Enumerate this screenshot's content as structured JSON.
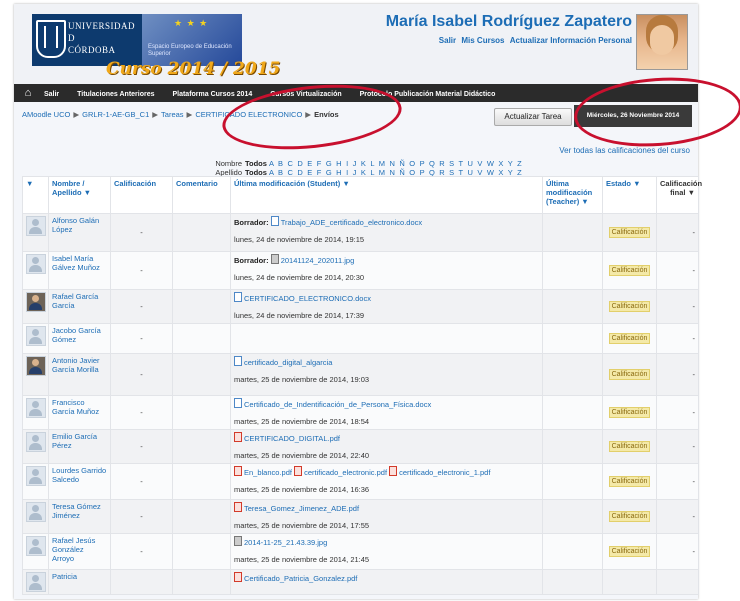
{
  "header": {
    "university": [
      "UNIVERSIDAD",
      "D",
      "CÓRDOBA"
    ],
    "eu_text": "Espacio Europeo de Educación Superior",
    "course_year": "Curso 2014 / 2015",
    "user_name": "María Isabel Rodríguez Zapatero",
    "links": [
      "Salir",
      "Mis Cursos",
      "Actualizar Información Personal"
    ]
  },
  "navbar": {
    "home_icon": "home-icon",
    "items": [
      "Salir",
      "Titulaciones Anteriores",
      "Plataforma Cursos 2014",
      "Cursos Virtualización",
      "Protocolo Publicación Material Didáctico"
    ]
  },
  "breadcrumb": {
    "items": [
      "AMoodle UCO",
      "GRLR-1-AE-GB_C1",
      "Tareas",
      "CERTIFICADO ELECTRONICO",
      "Envíos"
    ]
  },
  "toolbar": {
    "update_button": "Actualizar Tarea",
    "date": "Miércoles, 26 Noviembre 2014"
  },
  "view_all_link": "Ver todas las calificaciones del curso",
  "filters": {
    "nombre_label": "Nombre",
    "apellido_label": "Apellido",
    "all": "Todos",
    "letters": "A B C D E F G H I J K L M N Ñ O P Q R S T U V W X Y Z"
  },
  "table": {
    "headers": {
      "select": "▼",
      "name": "Nombre / Apellido ▼",
      "grade": "Calificación",
      "comment": "Comentario",
      "modified": "Última modificación (Student) ▼",
      "modified_teacher": "Última modificación (Teacher) ▼",
      "status": "Estado ▼",
      "final": "Calificación final ▼"
    },
    "rows": [
      {
        "name": "Alfonso Galán López",
        "photo": false,
        "grade": "-",
        "draft": "Borrador:",
        "files": [
          {
            "type": "odt",
            "name": "Trabajo_ADE_certificado_electronico.docx"
          }
        ],
        "date": "lunes, 24 de noviembre de 2014, 19:15",
        "status": "Calificación",
        "final": "-"
      },
      {
        "name": "Isabel María Gálvez Muñoz",
        "photo": false,
        "grade": "-",
        "draft": "Borrador:",
        "files": [
          {
            "type": "img",
            "name": "20141124_202011.jpg"
          }
        ],
        "date": "lunes, 24 de noviembre de 2014, 20:30",
        "status": "Calificación",
        "final": "-"
      },
      {
        "name": "Rafael García García",
        "photo": true,
        "grade": "-",
        "draft": "",
        "files": [
          {
            "type": "odt",
            "name": "CERTIFICADO_ELECTRONICO.docx"
          }
        ],
        "date": "lunes, 24 de noviembre de 2014, 17:39",
        "status": "Calificación",
        "final": "-"
      },
      {
        "name": "Jacobo García Gómez",
        "photo": false,
        "grade": "-",
        "draft": "",
        "files": [],
        "date": "",
        "status": "Calificación",
        "final": "-"
      },
      {
        "name": "Antonio Javier García Morilla",
        "photo": true,
        "grade": "-",
        "draft": "",
        "files": [
          {
            "type": "odt",
            "name": "certificado_digital_algarcia"
          }
        ],
        "date": "martes, 25 de noviembre de 2014, 19:03",
        "status": "Calificación",
        "final": "-"
      },
      {
        "name": "Francisco García Muñoz",
        "photo": false,
        "grade": "-",
        "draft": "",
        "files": [
          {
            "type": "odt",
            "name": "Certificado_de_Indentificación_de_Persona_Física.docx"
          }
        ],
        "date": "martes, 25 de noviembre de 2014, 18:54",
        "status": "Calificación",
        "final": "-"
      },
      {
        "name": "Emilio García Pérez",
        "photo": false,
        "grade": "-",
        "draft": "",
        "files": [
          {
            "type": "pdf",
            "name": "CERTIFICADO_DIGITAL.pdf"
          }
        ],
        "date": "martes, 25 de noviembre de 2014, 22:40",
        "status": "Calificación",
        "final": "-"
      },
      {
        "name": "Lourdes Garrido Salcedo",
        "photo": false,
        "grade": "-",
        "draft": "",
        "files": [
          {
            "type": "pdf",
            "name": "En_blanco.pdf"
          },
          {
            "type": "pdf",
            "name": "certificado_electronic.pdf"
          },
          {
            "type": "pdf",
            "name": "certificado_electronic_1.pdf"
          }
        ],
        "date": "martes, 25 de noviembre de 2014, 16:36",
        "status": "Calificación",
        "final": "-"
      },
      {
        "name": "Teresa Gómez Jiménez",
        "photo": false,
        "grade": "-",
        "draft": "",
        "files": [
          {
            "type": "pdf",
            "name": "Teresa_Gomez_Jimenez_ADE.pdf"
          }
        ],
        "date": "martes, 25 de noviembre de 2014, 17:55",
        "status": "Calificación",
        "final": "-"
      },
      {
        "name": "Rafael Jesús González Arroyo",
        "photo": false,
        "grade": "-",
        "draft": "",
        "files": [
          {
            "type": "img",
            "name": "2014-11-25_21.43.39.jpg"
          }
        ],
        "date": "martes, 25 de noviembre de 2014, 21:45",
        "status": "Calificación",
        "final": "-"
      },
      {
        "name": "Patricia",
        "photo": false,
        "grade": "",
        "draft": "",
        "files": [
          {
            "type": "pdf",
            "name": "Certificado_Patricia_Gonzalez.pdf"
          }
        ],
        "date": "",
        "status": "",
        "final": ""
      }
    ]
  }
}
